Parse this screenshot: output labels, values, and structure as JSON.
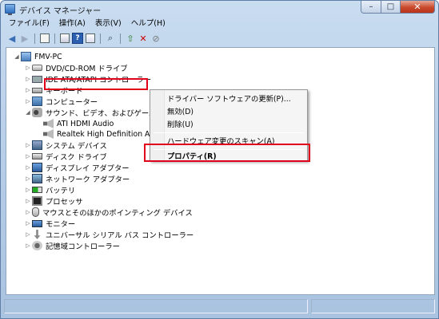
{
  "window": {
    "title": "デバイス マネージャー"
  },
  "window_controls": {
    "minimize": "–",
    "maximize": "□",
    "close": "✕"
  },
  "menu": [
    "ファイル(F)",
    "操作(A)",
    "表示(V)",
    "ヘルプ(H)"
  ],
  "toolbar": {
    "icons": [
      "back-arrow-icon",
      "forward-arrow-icon",
      "tree-view-icon",
      "properties-icon",
      "help-icon",
      "hardware-scan-icon",
      "update-driver-icon",
      "uninstall-icon",
      "disable-icon"
    ]
  },
  "tree": {
    "root": "FMV-PC",
    "items": [
      "DVD/CD-ROM ドライブ",
      "IDE ATA/ATAPI コントローラー",
      "キーボード",
      "コンピューター",
      "サウンド、ビデオ、およびゲーム コントローラー",
      "ATI HDMI Audio",
      "Realtek High Definition Audio",
      "システム デバイス",
      "ディスク ドライブ",
      "ディスプレイ アダプター",
      "ネットワーク アダプター",
      "バッテリ",
      "プロセッサ",
      "マウスとそのほかのポインティング デバイス",
      "モニター",
      "ユニバーサル シリアル バス コントローラー",
      "記憶域コントローラー"
    ]
  },
  "context_menu": {
    "update_driver": "ドライバー ソフトウェアの更新(P)...",
    "disable": "無効(D)",
    "uninstall": "削除(U)",
    "scan": "ハードウェア変更のスキャン(A)",
    "properties": "プロパティ(R)"
  },
  "colors": {
    "highlight_box": "#e0001a",
    "title_gradient_top": "#c9dcf0"
  }
}
